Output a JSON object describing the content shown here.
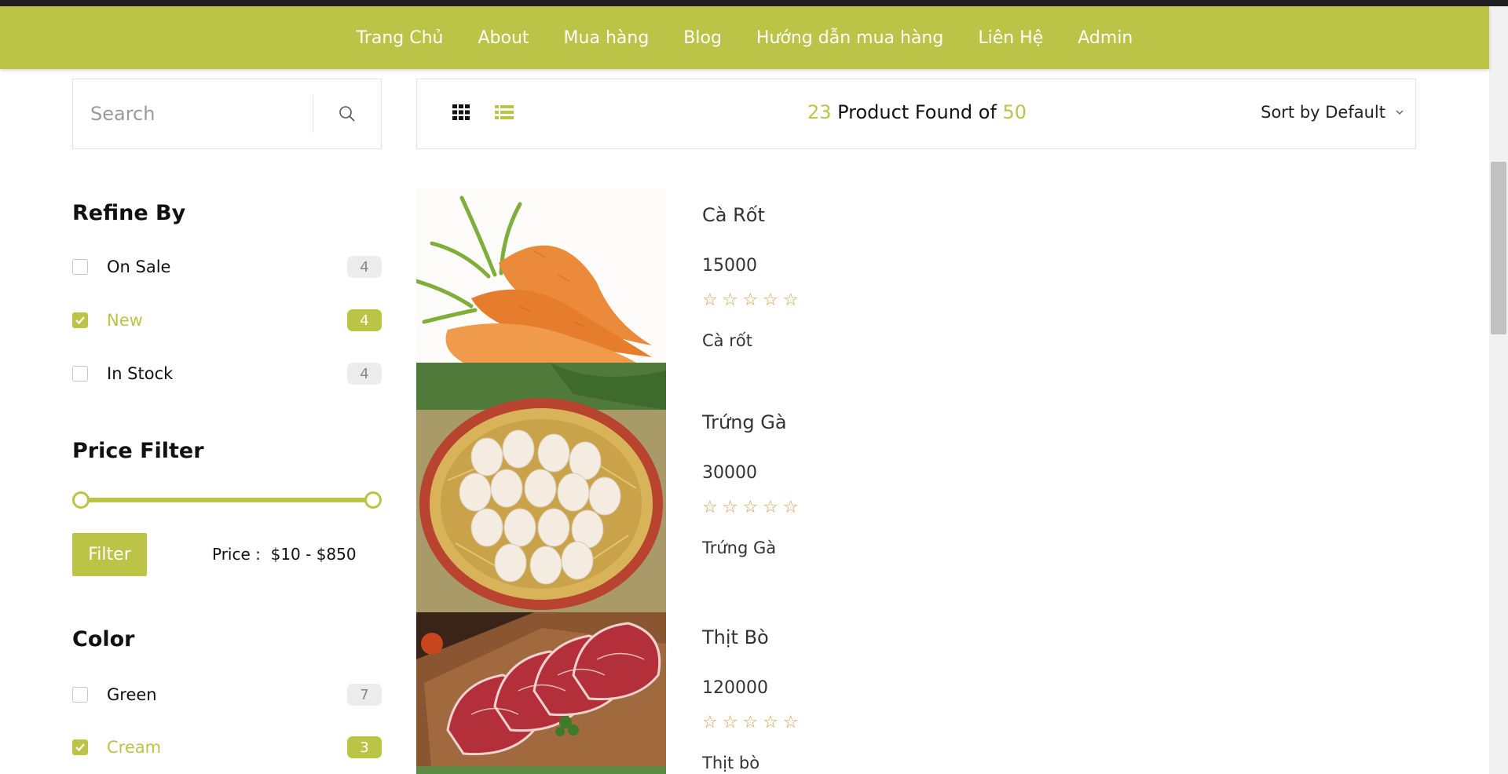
{
  "nav": {
    "items": [
      "Trang Chủ",
      "About",
      "Mua hàng",
      "Blog",
      "Hướng dẫn mua hàng",
      "Liên Hệ",
      "Admin"
    ]
  },
  "search": {
    "placeholder": "Search"
  },
  "toolbar": {
    "found_count": "23",
    "found_text": " Product Found of ",
    "total": "50",
    "sort_label": "Sort by Default"
  },
  "refine": {
    "title": "Refine By",
    "items": [
      {
        "label": "On Sale",
        "count": "4",
        "checked": false
      },
      {
        "label": "New",
        "count": "4",
        "checked": true
      },
      {
        "label": "In Stock",
        "count": "4",
        "checked": false
      }
    ]
  },
  "price_filter": {
    "title": "Price Filter",
    "button_label": "Filter",
    "range_text": "Price :  $10 - $850",
    "min": 10,
    "max": 850
  },
  "color_filter": {
    "title": "Color",
    "items": [
      {
        "label": "Green",
        "count": "7",
        "checked": false
      },
      {
        "label": "Cream",
        "count": "3",
        "checked": true
      }
    ]
  },
  "products": [
    {
      "name": "Cà Rốt",
      "price": "15000",
      "stars": "☆☆☆☆☆",
      "rating": 0,
      "desc": "Cà rốt",
      "image": "carrot"
    },
    {
      "name": "Trứng Gà",
      "price": "30000",
      "stars": "☆☆☆☆☆",
      "rating": 0,
      "desc": "Trứng Gà",
      "image": "eggs-basket"
    },
    {
      "name": "Thịt Bò",
      "price": "120000",
      "stars": "☆☆☆☆☆",
      "rating": 0,
      "desc": "Thịt bò",
      "image": "beef-slices"
    }
  ],
  "colors": {
    "accent": "#bbc446",
    "star": "#d4a24a"
  }
}
